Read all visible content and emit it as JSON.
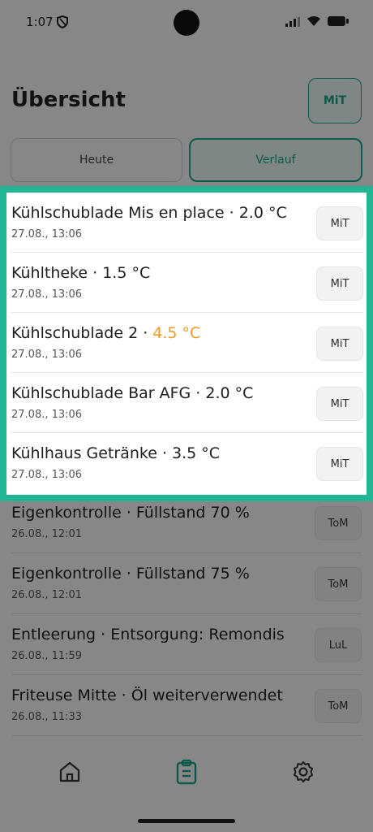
{
  "status_bar": {
    "time": "1:07"
  },
  "header": {
    "title": "Übersicht",
    "user_badge": "MiT"
  },
  "tabs": [
    {
      "label": "Heute",
      "active": false
    },
    {
      "label": "Verlauf",
      "active": true
    }
  ],
  "highlighted_entries": [
    {
      "title": "Kühlschublade Mis en place · ",
      "value": "2.0 °C",
      "warning": false,
      "time": "27.08., 13:06",
      "badge": "MiT"
    },
    {
      "title": "Kühltheke · ",
      "value": "1.5 °C",
      "warning": false,
      "time": "27.08., 13:06",
      "badge": "MiT"
    },
    {
      "title": "Kühlschublade 2 · ",
      "value": "4.5 °C",
      "warning": true,
      "time": "27.08., 13:06",
      "badge": "MiT"
    },
    {
      "title": "Kühlschublade Bar AFG · ",
      "value": "2.0 °C",
      "warning": false,
      "time": "27.08., 13:06",
      "badge": "MiT"
    },
    {
      "title": "Kühlhaus Getränke · ",
      "value": "3.5 °C",
      "warning": false,
      "time": "27.08., 13:06",
      "badge": "MiT"
    }
  ],
  "entries": [
    {
      "title": "Eigenkontrolle · Füllstand 70 %",
      "time": "26.08., 12:01",
      "badge": "ToM"
    },
    {
      "title": "Eigenkontrolle · Füllstand 75 %",
      "time": "26.08., 12:01",
      "badge": "ToM"
    },
    {
      "title": "Entleerung · Entsorgung: Remondis",
      "time": "26.08., 11:59",
      "badge": "LuL"
    },
    {
      "title": "Friteuse Mitte · Öl weiterverwendet",
      "time": "26.08., 11:33",
      "badge": "ToM"
    }
  ],
  "bottom_nav": [
    {
      "icon": "home-icon",
      "active": false
    },
    {
      "icon": "clipboard-icon",
      "active": true
    },
    {
      "icon": "gear-icon",
      "active": false
    }
  ],
  "colors": {
    "accent": "#1aa588",
    "warning": "#f29a1f",
    "highlight_border": "#21b594"
  }
}
